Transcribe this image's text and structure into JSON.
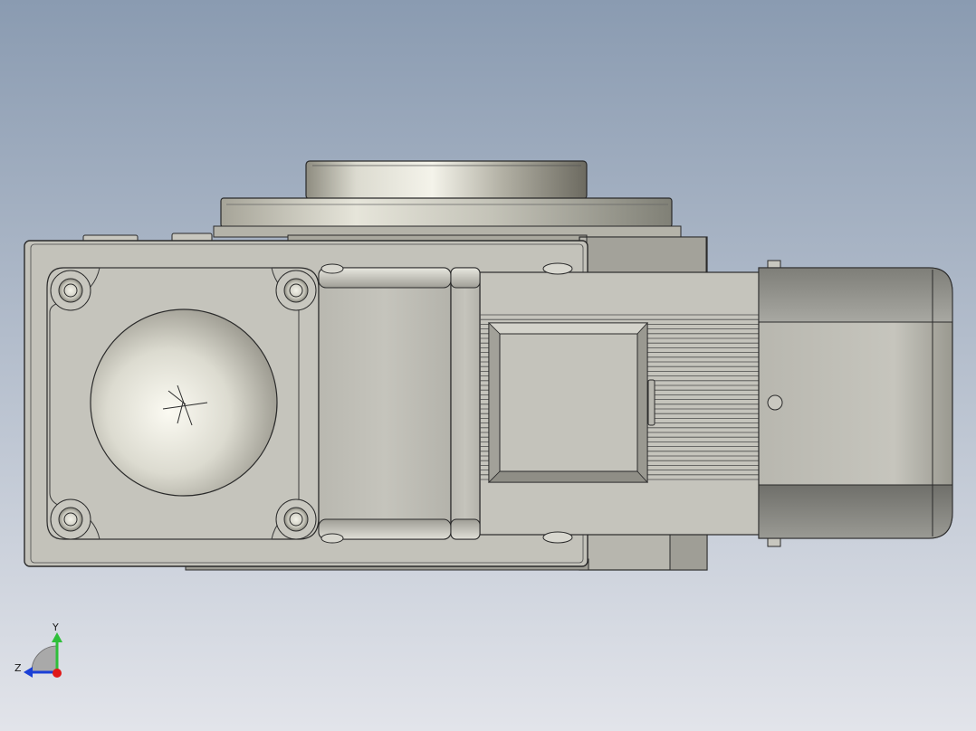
{
  "viewport": {
    "background_top": "#8a9bb1",
    "background_bottom": "#e2e4ea"
  },
  "model": {
    "body_color": "#c1c0b8",
    "outline_color": "#2a2a2a",
    "motor_band_color": "#8e8e88"
  },
  "triad": {
    "y_label": "Y",
    "z_label": "Z",
    "y_color": "#2fbf3a",
    "z_color": "#1a3fd6",
    "x_color": "#e01818"
  }
}
